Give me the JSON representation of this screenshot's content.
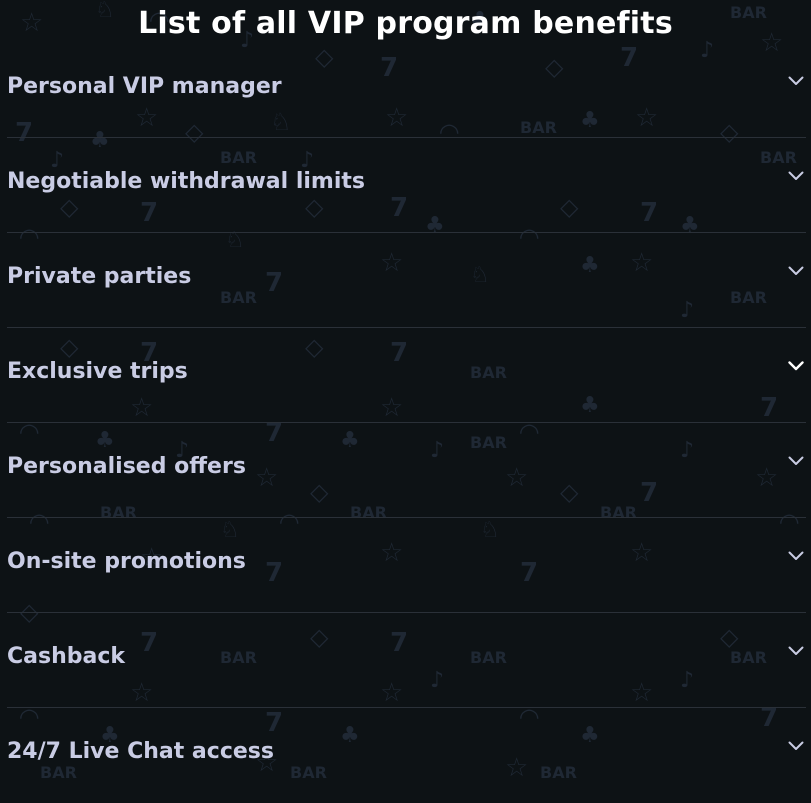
{
  "page": {
    "title": "List of all VIP program benefits"
  },
  "benefits": [
    {
      "label": "Personal VIP manager",
      "expanded": false
    },
    {
      "label": "Negotiable withdrawal limits",
      "expanded": false
    },
    {
      "label": "Private parties",
      "expanded": false
    },
    {
      "label": "Exclusive trips",
      "expanded": false
    },
    {
      "label": "Personalised offers",
      "expanded": false
    },
    {
      "label": "On-site promotions",
      "expanded": false
    },
    {
      "label": "Cashback",
      "expanded": false
    },
    {
      "label": "24/7 Live Chat access",
      "expanded": false
    }
  ],
  "icons": {
    "toggle": "chevron-down-icon"
  },
  "colors": {
    "background": "#0d1215",
    "title": "#ffffff",
    "label": "#c9cce4",
    "divider": "#2a3038",
    "chevron": "#c9cce4",
    "pattern": "#1f2834"
  }
}
